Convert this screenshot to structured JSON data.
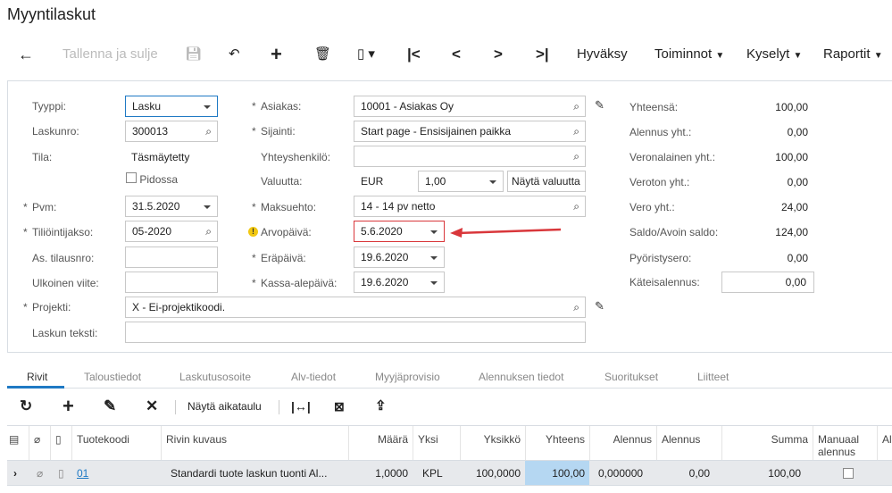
{
  "title": "Myyntilaskut",
  "toolbar": {
    "back": "←",
    "save_close": "Tallenna ja sulje",
    "approve": "Hyväksy",
    "actions": "Toiminnot",
    "inquiries": "Kyselyt",
    "reports": "Raportit"
  },
  "form": {
    "type_label": "Tyyppi:",
    "type_value": "Lasku",
    "invno_label": "Laskunro:",
    "invno_value": "300013",
    "status_label": "Tila:",
    "status_value": "Täsmäytetty",
    "hold_label": "Pidossa",
    "date_label": "Pvm:",
    "date_value": "31.5.2020",
    "period_label": "Tiliöintijakso:",
    "period_value": "05-2020",
    "custorder_label": "As. tilausnro:",
    "custorder_value": "",
    "extref_label": "Ulkoinen viite:",
    "extref_value": "",
    "project_label": "Projekti:",
    "project_value": "X - Ei-projektikoodi.",
    "desc_label": "Laskun teksti:",
    "desc_value": "",
    "customer_label": "Asiakas:",
    "customer_value": "10001 - Asiakas Oy",
    "location_label": "Sijainti:",
    "location_value": "Start page - Ensisijainen paikka",
    "contact_label": "Yhteyshenkilö:",
    "contact_value": "",
    "currency_label": "Valuutta:",
    "currency_value": "EUR",
    "rate_value": "1,00",
    "show_currency": "Näytä valuutta",
    "terms_label": "Maksuehto:",
    "terms_value": "14 - 14 pv netto",
    "valuedate_label": "Arvopäivä:",
    "valuedate_value": "5.6.2020",
    "duedate_label": "Eräpäivä:",
    "duedate_value": "19.6.2020",
    "cashdisc_label": "Kassa-alepäivä:",
    "cashdisc_value": "19.6.2020",
    "totals": [
      {
        "label": "Yhteensä:",
        "value": "100,00"
      },
      {
        "label": "Alennus yht.:",
        "value": "0,00"
      },
      {
        "label": "Veronalainen yht.:",
        "value": "100,00"
      },
      {
        "label": "Veroton yht.:",
        "value": "0,00"
      },
      {
        "label": "Vero yht.:",
        "value": "24,00"
      },
      {
        "label": "Saldo/Avoin saldo:",
        "value": "124,00"
      },
      {
        "label": "Pyöristysero:",
        "value": "0,00"
      }
    ],
    "cash_discount_label": "Käteisalennus:",
    "cash_discount_value": "0,00"
  },
  "tabs": [
    "Rivit",
    "Taloustiedot",
    "Laskutusosoite",
    "Alv-tiedot",
    "Myyjäprovisio",
    "Alennuksen tiedot",
    "Suoritukset",
    "Liitteet"
  ],
  "grid_toolbar": {
    "show_schedule": "Näytä aikataulu"
  },
  "grid": {
    "headers": [
      "Tuotekoodi",
      "Rivin kuvaus",
      "Määrä",
      "Yksi",
      "Yksikkö",
      "Yhteens",
      "Alennus",
      "Alennus",
      "Summa",
      "Manuaal alennus",
      "Al"
    ],
    "row": {
      "code": "01",
      "desc": "Standardi tuote laskun tuonti Al...",
      "qty": "1,0000",
      "uom": "KPL",
      "unit": "100,0000",
      "ext": "100,00",
      "discpct": "0,000000",
      "disc": "0,00",
      "amount": "100,00",
      "manual": false
    }
  },
  "colors": {
    "accent": "#1f79c4",
    "error": "#d9373b",
    "selected_cell": "#b5d7f2"
  }
}
